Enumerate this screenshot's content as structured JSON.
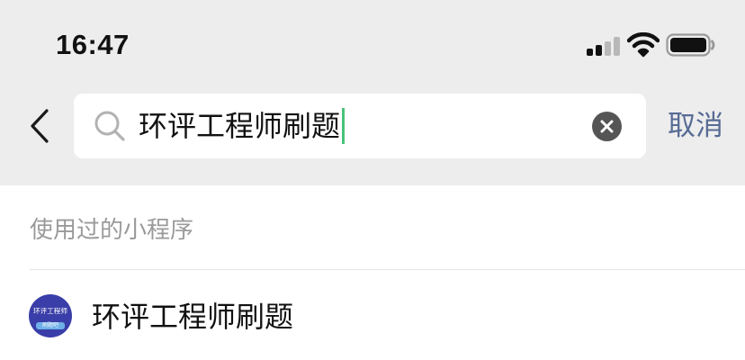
{
  "status_bar": {
    "time": "16:47",
    "signal_icon": "cellular-signal-icon",
    "wifi_icon": "wifi-icon",
    "battery_icon": "battery-icon"
  },
  "search_bar": {
    "back_icon": "chevron-left-icon",
    "search_icon": "search-icon",
    "query": "环评工程师刷题",
    "clear_icon": "clear-icon",
    "cancel_label": "取消"
  },
  "results": {
    "section_title": "使用过的小程序",
    "items": [
      {
        "name": "环评工程师刷题",
        "avatar_text": "环评工程师",
        "avatar_badge": "刷题吧"
      }
    ]
  },
  "colors": {
    "accent": "#576b95",
    "caret": "#48c27a",
    "header_bg": "#ededed",
    "avatar_bg": "#3a3ea8"
  }
}
